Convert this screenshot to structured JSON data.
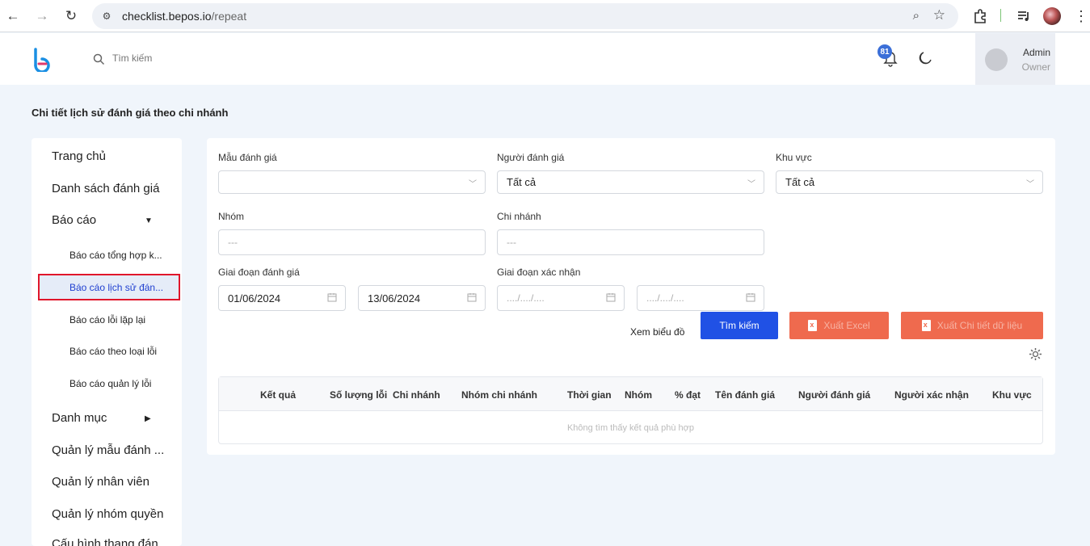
{
  "browser": {
    "url_host": "checklist.bepos.io",
    "url_path": "/repeat"
  },
  "header": {
    "search_placeholder": "Tìm kiếm",
    "notification_count": "81",
    "user_name": "Admin",
    "user_role": "Owner"
  },
  "page": {
    "title": "Chi tiết lịch sử đánh giá theo chi nhánh"
  },
  "sidebar": {
    "items": [
      {
        "label": "Trang chủ"
      },
      {
        "label": "Danh sách đánh giá"
      },
      {
        "label": "Báo cáo"
      },
      {
        "label": "Báo cáo tổng hợp k..."
      },
      {
        "label": "Báo cáo lịch sử đán..."
      },
      {
        "label": "Báo cáo lỗi lặp lại"
      },
      {
        "label": "Báo cáo theo loại lỗi"
      },
      {
        "label": "Báo cáo quản lý lỗi"
      },
      {
        "label": "Danh mục"
      },
      {
        "label": "Quản lý mẫu đánh ..."
      },
      {
        "label": "Quản lý nhân viên"
      },
      {
        "label": "Quản lý nhóm quyền"
      },
      {
        "label": "Cấu hình thang đán"
      }
    ]
  },
  "filters": {
    "template_label": "Mẫu đánh giá",
    "template_value": "",
    "evaluator_label": "Người đánh giá",
    "evaluator_value": "Tất cả",
    "area_label": "Khu vực",
    "area_value": "Tất cả",
    "group_label": "Nhóm",
    "group_placeholder": "---",
    "branch_label": "Chi nhánh",
    "branch_placeholder": "---",
    "eval_period_label": "Giai đoạn đánh giá",
    "eval_from": "01/06/2024",
    "eval_to": "13/06/2024",
    "confirm_period_label": "Giai đoạn xác nhận",
    "confirm_from_placeholder": "..../..../....",
    "confirm_to_placeholder": "..../..../...."
  },
  "actions": {
    "view_chart": "Xem biểu đồ",
    "search": "Tìm kiếm",
    "export_excel": "Xuất Excel",
    "export_detail": "Xuất Chi tiết dữ liệu"
  },
  "table": {
    "columns": [
      "Kết quả",
      "Số lượng lỗi",
      "Chi nhánh",
      "Nhóm chi nhánh",
      "Thời gian",
      "Nhóm",
      "% đạt",
      "Tên đánh giá",
      "Người đánh giá",
      "Người xác nhận",
      "Khu vực"
    ],
    "empty_text": "Không tìm thấy kết quả phù hợp"
  },
  "colors": {
    "primary": "#2051e5",
    "excel": "#ef6a4e",
    "active_border": "#e0162b"
  }
}
